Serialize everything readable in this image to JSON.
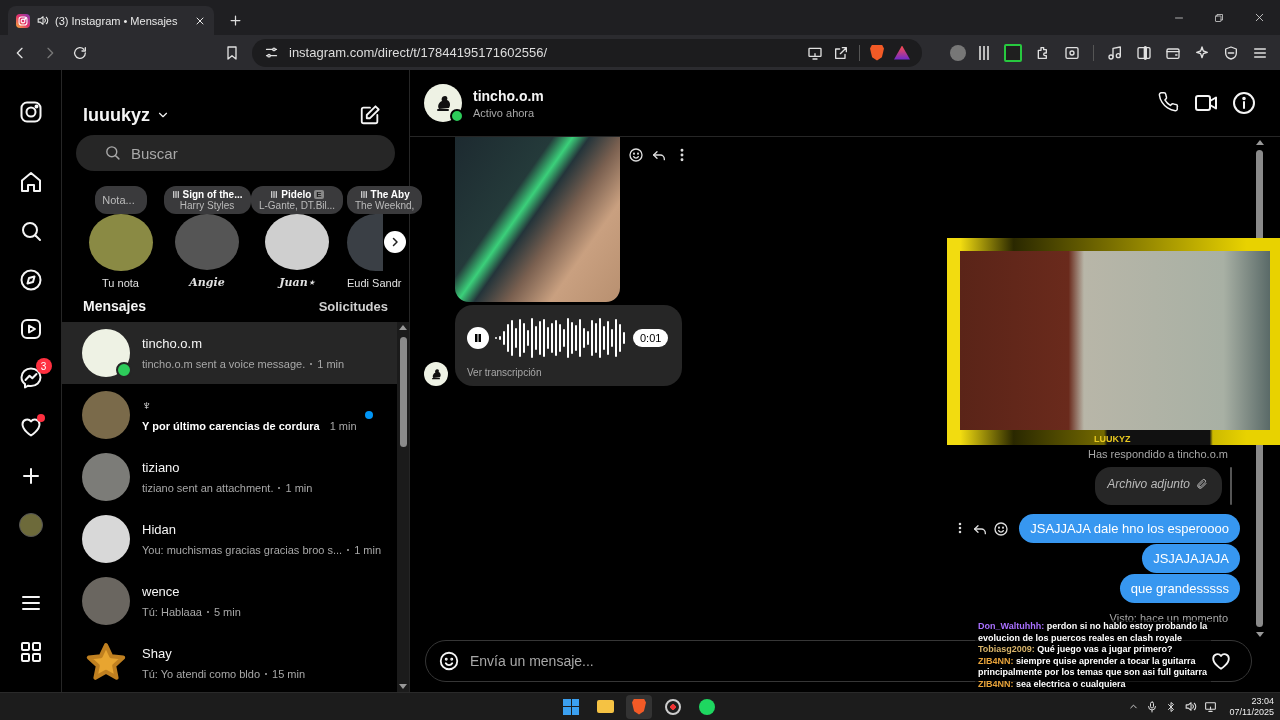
{
  "browser": {
    "tab": {
      "title": "(3) Instagram • Mensajes",
      "audio_playing": true
    },
    "url": "instagram.com/direct/t/17844195171602556/"
  },
  "nav": {
    "messages_badge": "3",
    "notifications_dot": true
  },
  "inbox": {
    "account": "luuukyz",
    "search_placeholder": "Buscar",
    "notes": [
      {
        "kind": "own",
        "bubble": "Nota...",
        "name": "Tu nota"
      },
      {
        "kind": "music",
        "song": "Sign of the...",
        "artist": "Harry Styles",
        "name": "Angie"
      },
      {
        "kind": "music",
        "song": "Pidelo",
        "explicit_badge": "E",
        "artist": "L-Gante, DT.Bil...",
        "name": "Juan⋆"
      },
      {
        "kind": "music",
        "song": "The Aby",
        "artist": "The Weeknd,",
        "name": "Eudi Sandr"
      }
    ],
    "section_title": "Mensajes",
    "requests_link": "Solicitudes",
    "conversations": [
      {
        "name": "tincho.o.m",
        "preview": "tincho.o.m sent a voice message.",
        "time": "1 min",
        "selected": true,
        "unread": false,
        "online": true
      },
      {
        "name": "♆",
        "preview": "Y por último carencias de cordura",
        "time": "1 min",
        "selected": false,
        "unread": true,
        "online": false
      },
      {
        "name": "tiziano",
        "preview": "tiziano sent an attachment.",
        "time": "1 min",
        "selected": false,
        "unread": false,
        "online": false
      },
      {
        "name": "Hidan",
        "preview": "You: muchismas gracias gracias broo s...",
        "time": "1 min",
        "selected": false,
        "unread": false,
        "online": false
      },
      {
        "name": "wence",
        "preview": "Tú: Hablaaa",
        "time": "5 min",
        "selected": false,
        "unread": false,
        "online": false
      },
      {
        "name": "Shay",
        "preview": "Tú: Yo atendi como bldo",
        "time": "15 min",
        "selected": false,
        "unread": false,
        "online": false
      }
    ]
  },
  "chat": {
    "contact": "tincho.o.m",
    "status": "Activo ahora",
    "online": true,
    "voice_message": {
      "playing": true,
      "duration": "0:01",
      "transcript_link": "Ver transcripción"
    },
    "reply_label": "Has respondido a tincho.o.m",
    "reply_quote": "Archivo adjunto",
    "sent": [
      "JSAJJAJA dale hno los esperoooo",
      "JSJAJAJAJA",
      "que grandesssss"
    ],
    "seen": "Visto: hace un momento",
    "composer_placeholder": "Envía un mensaje..."
  },
  "stream": {
    "webcam_label": "LUUKYZ",
    "chat": [
      {
        "user": "Don_Waltuhhh:",
        "color": "#a970ff",
        "text": "perdon si no hablo estoy probando la evolucion de los puercos reales en clash royale"
      },
      {
        "user": "Tobiasg2009:",
        "color": "#d8b46a",
        "text": "Qué juego vas a jugar primero?"
      },
      {
        "user": "ZIB4NN:",
        "color": "#e8a33a",
        "text": "siempre quise aprender a tocar la guitarra principalmente por los temas que son asi full guitarra"
      },
      {
        "user": "ZIB4NN:",
        "color": "#e8a33a",
        "text": "sea electrica o cualquiera"
      }
    ]
  },
  "taskbar": {
    "time": "23:04",
    "date": "07/11/2025"
  }
}
